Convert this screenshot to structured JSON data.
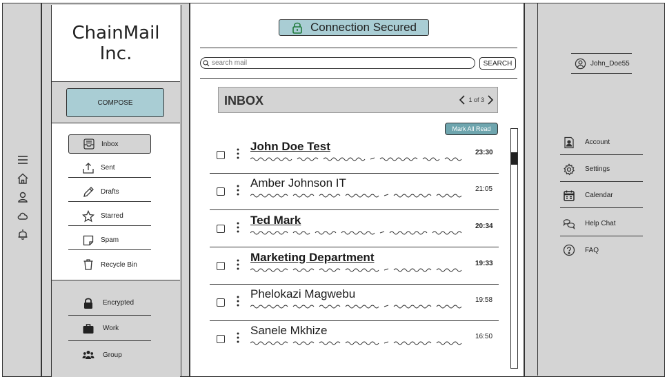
{
  "app": {
    "logo_line1": "ChainMail",
    "logo_line2": "Inc."
  },
  "rail": {
    "icons": [
      "menu-icon",
      "home-icon",
      "profile-icon",
      "cloud-icon",
      "bell-icon"
    ]
  },
  "nav": {
    "compose_label": "COMPOSE",
    "folders": [
      {
        "label": "Inbox",
        "icon": "inbox-icon",
        "active": true
      },
      {
        "label": "Sent",
        "icon": "upload-icon"
      },
      {
        "label": "Drafts",
        "icon": "pencil-icon"
      },
      {
        "label": "Starred",
        "icon": "star-icon"
      },
      {
        "label": "Spam",
        "icon": "note-icon"
      },
      {
        "label": "Recycle Bin",
        "icon": "trash-icon"
      }
    ],
    "labels": [
      {
        "label": "Encrypted",
        "icon": "lock-icon"
      },
      {
        "label": "Work",
        "icon": "briefcase-icon"
      },
      {
        "label": "Group",
        "icon": "people-icon"
      }
    ]
  },
  "main": {
    "security_status": "Connection Secured",
    "search_placeholder": "search mail",
    "search_button": "SEARCH",
    "folder_title": "INBOX",
    "pager": "1 of 3",
    "mark_all_read": "Mark All Read",
    "emails": [
      {
        "sender": "John Doe Test",
        "time": "23:30",
        "unread": true
      },
      {
        "sender": "Amber Johnson IT",
        "time": "21:05",
        "unread": false
      },
      {
        "sender": "Ted Mark",
        "time": "20:34",
        "unread": true
      },
      {
        "sender": "Marketing Department",
        "time": "19:33",
        "unread": true
      },
      {
        "sender": "Phelokazi Magwebu",
        "time": "19:58",
        "unread": false
      },
      {
        "sender": "Sanele Mkhize",
        "time": "16:50",
        "unread": false
      }
    ]
  },
  "right": {
    "username": "John_Doe55",
    "items": [
      {
        "label": "Account",
        "icon": "account-icon"
      },
      {
        "label": "Settings",
        "icon": "gear-icon"
      },
      {
        "label": "Calendar",
        "icon": "calendar-icon"
      },
      {
        "label": "Help Chat",
        "icon": "chat-icon"
      },
      {
        "label": "FAQ",
        "icon": "question-icon"
      }
    ]
  },
  "colors": {
    "panel_gray": "#d4d4d4",
    "accent_teal": "#a9cdd4",
    "button_teal": "#6ea5ae",
    "line": "#333333"
  }
}
